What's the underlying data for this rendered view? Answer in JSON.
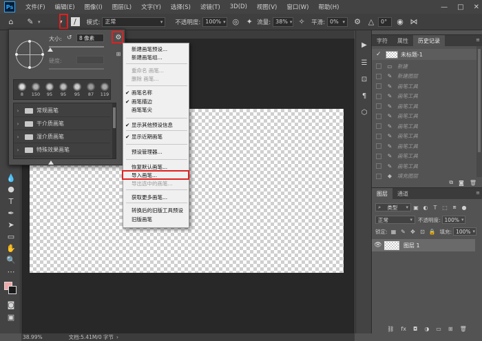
{
  "menubar": {
    "logo": "Ps",
    "items": [
      "文件(F)",
      "编辑(E)",
      "图像(I)",
      "图层(L)",
      "文字(Y)",
      "选择(S)",
      "滤镜(T)",
      "3D(D)",
      "视图(V)",
      "窗口(W)",
      "帮助(H)"
    ],
    "window_controls": [
      "—",
      "□",
      "✕"
    ]
  },
  "options": {
    "mode_label": "模式:",
    "mode_value": "正常",
    "opacity_label": "不透明度:",
    "opacity_value": "100%",
    "flow_label": "流量:",
    "flow_value": "38%",
    "smooth_label": "平滑:",
    "smooth_value": "0%",
    "angle_value": "0°"
  },
  "brush_picker": {
    "size_label": "大小:",
    "size_value": "8 像素",
    "hardness_label": "硬度:",
    "recent_sizes": [
      "8",
      "150",
      "95",
      "95",
      "95",
      "87",
      "119"
    ],
    "folders": [
      "常规画笔",
      "干介质画笔",
      "湿介质画笔",
      "特殊效果画笔"
    ]
  },
  "context_menu": {
    "items": [
      {
        "label": "新建画笔预设...",
        "checked": false,
        "disabled": false
      },
      {
        "label": "新建画笔组...",
        "checked": false,
        "disabled": false
      },
      {
        "label": "重命名 画笔...",
        "checked": false,
        "disabled": true
      },
      {
        "label": "删除 画笔...",
        "checked": false,
        "disabled": true
      },
      {
        "label": "画笔名称",
        "checked": true,
        "disabled": false
      },
      {
        "label": "画笔描边",
        "checked": true,
        "disabled": false
      },
      {
        "label": "画笔笔尖",
        "checked": false,
        "disabled": false
      },
      {
        "label": "显示其他预设信息",
        "checked": true,
        "disabled": false
      },
      {
        "label": "显示近期画笔",
        "checked": true,
        "disabled": false
      },
      {
        "label": "预设管理器...",
        "checked": false,
        "disabled": false
      },
      {
        "label": "恢复默认画笔...",
        "checked": false,
        "disabled": false
      },
      {
        "label": "导入画笔...",
        "checked": false,
        "disabled": false
      },
      {
        "label": "导出选中的画笔...",
        "checked": false,
        "disabled": true
      },
      {
        "label": "获取更多画笔...",
        "checked": false,
        "disabled": false
      },
      {
        "label": "转换后的旧版工具预设",
        "checked": false,
        "disabled": false
      },
      {
        "label": "旧版画笔",
        "checked": false,
        "disabled": false
      }
    ]
  },
  "status": {
    "zoom": "38.99%",
    "doc_info": "文档:5.41M/0 字节"
  },
  "history": {
    "tabs": [
      "字符",
      "属性",
      "历史记录"
    ],
    "active_tab": 2,
    "snapshot_label": "未标题-1",
    "states": [
      "新建",
      "新建图层",
      "画笔工具",
      "画笔工具",
      "画笔工具",
      "画笔工具",
      "画笔工具",
      "画笔工具",
      "画笔工具",
      "画笔工具",
      "画笔工具",
      "填充图层"
    ]
  },
  "layers": {
    "tabs": [
      "图层",
      "通道"
    ],
    "active_tab": 0,
    "filter_label": "类型",
    "blend_mode": "正常",
    "opacity_label": "不透明度:",
    "opacity_value": "100%",
    "lock_label": "锁定:",
    "fill_label": "填充:",
    "fill_value": "100%",
    "layer_name": "图层 1"
  },
  "colors": {
    "highlight": "#e02020",
    "foreground_swatch": "#f0a8a8",
    "background_swatch": "#1a1a1a"
  }
}
